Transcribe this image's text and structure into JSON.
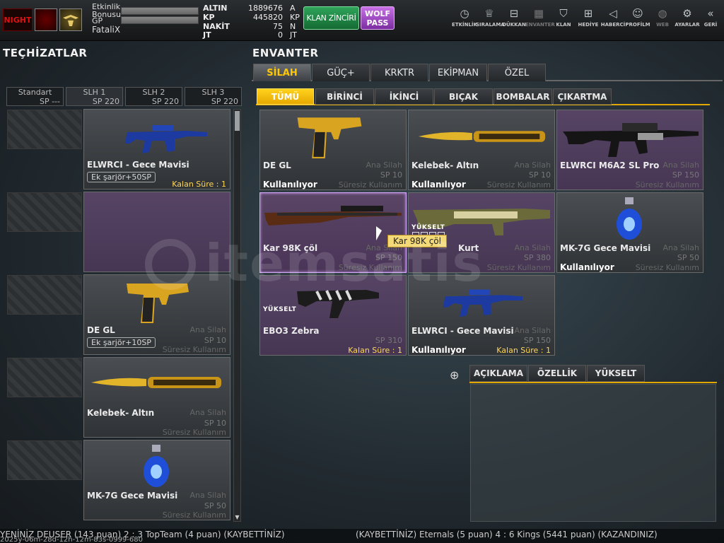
{
  "topbar": {
    "level_label": "NIGHT",
    "stats_labels": {
      "event": "Etkinlik\nBonusu",
      "gp": "GP"
    },
    "player_name": "FataliX",
    "currency": [
      {
        "label": "ALTIN",
        "value": "1889676",
        "unit": "A"
      },
      {
        "label": "KP",
        "value": "445820",
        "unit": "KP"
      },
      {
        "label": "NAKİT",
        "value": "75",
        "unit": "N"
      },
      {
        "label": "JT",
        "value": "0",
        "unit": "JT"
      }
    ],
    "klan_button": "KLAN ZİNCİRİ",
    "wolf_button": "WOLF PASS",
    "nav": [
      {
        "icon": "clock-icon",
        "label": "ETKİNLİK"
      },
      {
        "icon": "rank-icon",
        "label": "SIRALAMA"
      },
      {
        "icon": "cart-icon",
        "label": "DÜKKAN"
      },
      {
        "icon": "inventory-icon",
        "label": "ENVANTER"
      },
      {
        "icon": "shield-icon",
        "label": "KLAN"
      },
      {
        "icon": "gift-icon",
        "label": "HEDİYE"
      },
      {
        "icon": "megaphone-icon",
        "label": "HABERCİ"
      },
      {
        "icon": "profile-icon",
        "label": "PROFİLM"
      },
      {
        "icon": "globe-icon",
        "label": "WEB"
      },
      {
        "icon": "gear-icon",
        "label": "AYARLAR"
      },
      {
        "icon": "back-icon",
        "label": "GERİ"
      }
    ]
  },
  "left": {
    "title": "TEÇHİZATLAR",
    "slots": [
      {
        "name": "Standart",
        "sp": "SP ---"
      },
      {
        "name": "SLH 1",
        "sp": "SP 220"
      },
      {
        "name": "SLH 2",
        "sp": "SP 220"
      },
      {
        "name": "SLH 3",
        "sp": "SP 220"
      }
    ],
    "items": [
      {
        "name": "ELWRCI - Gece Mavisi",
        "extra": "Ek şarjör+50SP",
        "status": "Kalan Süre : 1"
      },
      {
        "name": "",
        "extra": "",
        "status": ""
      },
      {
        "name": "DE GL",
        "type": "Ana Silah",
        "sp": "SP 10",
        "extra": "Ek şarjör+10SP",
        "status": "Süresiz Kullanım"
      },
      {
        "name": "Kelebek- Altın",
        "type": "Ana Silah",
        "sp": "SP 10",
        "status": "Süresiz Kullanım"
      },
      {
        "name": "MK-7G Gece Mavisi",
        "type": "Ana Silah",
        "sp": "SP 50",
        "status": "Süresiz Kullanım"
      }
    ]
  },
  "inventory": {
    "title": "ENVANTER",
    "main_tabs": [
      "SİLAH",
      "GÜÇ+",
      "KRKTR",
      "EKİPMAN",
      "ÖZEL"
    ],
    "sub_tabs": [
      "TÜMÜ",
      "BİRİNCİ",
      "İKİNCİ",
      "BIÇAK",
      "BOMBALAR",
      "ÇIKARTMA"
    ],
    "items": [
      {
        "name": "DE GL",
        "type": "Ana Silah",
        "sp": "SP 10",
        "use": "Kullanılıyor",
        "status": "Süresiz Kullanım"
      },
      {
        "name": "Kelebek- Altın",
        "type": "Ana Silah",
        "sp": "SP 10",
        "use": "Kullanılıyor",
        "status": "Süresiz Kullanım"
      },
      {
        "name": "ELWRCI M6A2 SL Pro",
        "type": "Ana Silah",
        "sp": "SP 150",
        "use": "",
        "status": "Süresiz Kullanım"
      },
      {
        "name": "Kar 98K çöl",
        "type": "Ana Silah",
        "sp": "SP 150",
        "use": "",
        "status": "Süresiz Kullanım"
      },
      {
        "name": "Kurt",
        "type": "Ana Silah",
        "sp": "SP 380",
        "use": "",
        "status": "Süresiz Kullanım",
        "upgrade": "YÜKSELT"
      },
      {
        "name": "MK-7G Gece Mavisi",
        "type": "Ana Silah",
        "sp": "SP 50",
        "use": "Kullanılıyor",
        "status": "Süresiz Kullanım"
      },
      {
        "name": "EBO3 Zebra",
        "type": "",
        "sp": "SP 310",
        "use": "",
        "status": "Kalan Süre : 1",
        "upgrade": "YÜKSELT"
      },
      {
        "name": "ELWRCI - Gece Mavisi",
        "type": "Ana Silah",
        "sp": "SP 150",
        "use": "Kullanılıyor",
        "status": "Kalan Süre : 1"
      }
    ],
    "tooltip": "Kar 98K çöl"
  },
  "detail_tabs": [
    "AÇIKLAMA",
    "ÖZELLİK",
    "YÜKSELT"
  ],
  "ticker": {
    "line1": "YENİNİZ DEUSER (143 puan) 2 : 3 TopTeam (4 puan) (KAYBETTİNİZ)",
    "line1b": "(KAYBETTİNİZ) Eternals (5 puan) 4 : 6 Kings (5441 puan) (KAZANDINIZ)",
    "line2": "2025y-06m-28d-12h-12m-83s-0999-680"
  },
  "watermark": "itemsatis",
  "colors": {
    "accent": "#ffc800",
    "selected": "#d8a8ff",
    "klan": "#2fa35a",
    "wolf": "#b35fd6"
  }
}
